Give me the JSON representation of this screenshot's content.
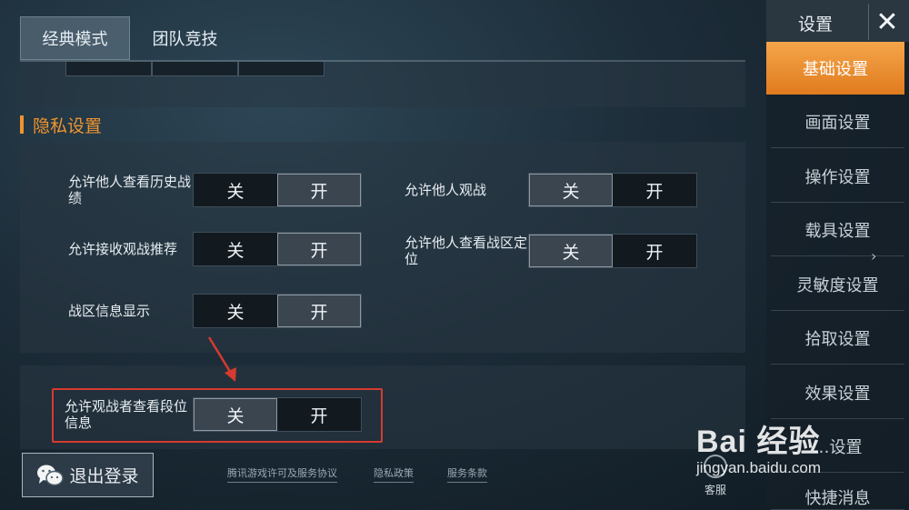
{
  "tabs": [
    {
      "label": "经典模式",
      "active": true
    },
    {
      "label": "团队竞技",
      "active": false
    }
  ],
  "section_title": "隐私设置",
  "toggle_options": {
    "off": "关",
    "on": "开"
  },
  "settings": [
    {
      "label": "允许他人查看历史战绩",
      "selected": "开"
    },
    {
      "label": "允许他人观战",
      "selected": "关"
    },
    {
      "label": "允许接收观战推荐",
      "selected": "开"
    },
    {
      "label": "允许他人查看战区定位",
      "selected": "关"
    },
    {
      "label": "战区信息显示",
      "selected": "开"
    },
    {
      "label": "允许观战者查看段位信息",
      "selected": "关"
    }
  ],
  "logout_label": "退出登录",
  "footer_links": [
    "腾讯游戏许可及服务协议",
    "隐私政策",
    "服务条款"
  ],
  "kefu_label": "客服",
  "sidebar": {
    "title": "设置",
    "items": [
      {
        "label": "基础设置",
        "active": true
      },
      {
        "label": "画面设置",
        "active": false
      },
      {
        "label": "操作设置",
        "active": false
      },
      {
        "label": "载具设置",
        "active": false
      },
      {
        "label": "灵敏度设置",
        "active": false
      },
      {
        "label": "拾取设置",
        "active": false
      },
      {
        "label": "效果设置",
        "active": false
      },
      {
        "label": "…设置",
        "active": false
      },
      {
        "label": "快捷消息",
        "active": false
      }
    ]
  },
  "watermark": {
    "main": "Bai 经验",
    "sub": "jingyan.baidu.com"
  },
  "colors": {
    "accent": "#f0922f",
    "highlight": "#d63a30",
    "sidebar_active": "#e8871f"
  }
}
